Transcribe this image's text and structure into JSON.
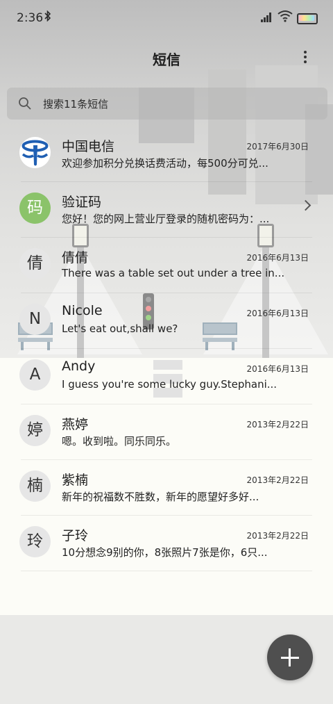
{
  "status_bar": {
    "time": "2:36"
  },
  "header": {
    "title": "短信"
  },
  "search": {
    "placeholder": "搜索11条短信"
  },
  "messages": [
    {
      "name": "中国电信",
      "date": "2017年6月30日",
      "snippet": "欢迎参加积分兑换话费活动，每500分可兑...",
      "avatar": ""
    },
    {
      "name": "验证码",
      "date": "",
      "snippet": "您好！您的网上营业厅登录的随机密码为：...",
      "avatar": "码"
    },
    {
      "name": "倩倩",
      "date": "2016年6月13日",
      "snippet": "There was a table set out under a tree in...",
      "avatar": "倩"
    },
    {
      "name": "Nicole",
      "date": "2016年6月13日",
      "snippet": "Let's eat out,shall we?",
      "avatar": "N"
    },
    {
      "name": "Andy",
      "date": "2016年6月13日",
      "snippet": "I guess you're some lucky guy.Stephani...",
      "avatar": "A"
    },
    {
      "name": "燕婷",
      "date": "2013年2月22日",
      "snippet": "嗯。收到啦。同乐同乐。",
      "avatar": "婷"
    },
    {
      "name": "紫楠",
      "date": "2013年2月22日",
      "snippet": "新年的祝福数不胜数，新年的愿望好多好...",
      "avatar": "楠"
    },
    {
      "name": "子玲",
      "date": "2013年2月22日",
      "snippet": "10分想念9别的你，8张照片7张是你，6只...",
      "avatar": "玲"
    }
  ],
  "icons": {
    "bluetooth": "bluetooth-icon",
    "signal": "signal-icon",
    "wifi": "wifi-icon",
    "battery": "battery-icon",
    "more": "more-vertical-icon",
    "search": "search-icon",
    "chevron": "chevron-right-icon",
    "compose": "plus-icon"
  },
  "colors": {
    "avatar_green": "#8bc36a",
    "fab": "#4f4f4f",
    "telecom_blue": "#1f5fb3"
  }
}
